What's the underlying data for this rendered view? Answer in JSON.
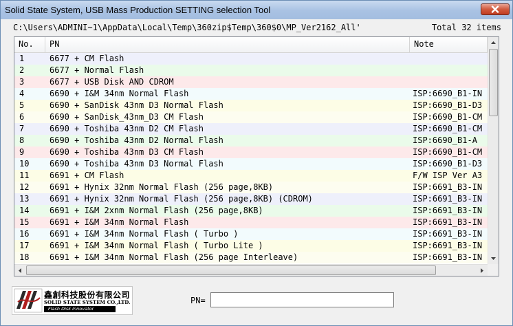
{
  "window": {
    "title": "Solid State System, USB Mass Production SETTING selection Tool",
    "close_icon": "close-icon"
  },
  "path_text": "C:\\Users\\ADMINI~1\\AppData\\Local\\Temp\\360zip$Temp\\360$0\\MP_Ver2162_All'",
  "total_text": "Total 32 items",
  "list": {
    "columns": [
      "No.",
      "PN",
      "Note"
    ],
    "rows": [
      {
        "no": "1",
        "pn": "6677 + CM Flash",
        "note": "",
        "color": "#eef0fb"
      },
      {
        "no": "2",
        "pn": "6677 + Normal Flash",
        "note": "",
        "color": "#eafbea"
      },
      {
        "no": "3",
        "pn": "6677 + USB Disk AND CDROM",
        "note": "",
        "color": "#fde9ea"
      },
      {
        "no": "4",
        "pn": "6690 + I&M 34nm Normal Flash",
        "note": "ISP:6690_B1-IN",
        "color": "#f2fbfd"
      },
      {
        "no": "5",
        "pn": "6690 + SanDisk 43nm D3 Normal Flash",
        "note": "ISP:6690_B1-D3",
        "color": "#fdfde6"
      },
      {
        "no": "6",
        "pn": "6690 + SanDisk_43nm_D3 CM Flash",
        "note": "ISP:6690_B1-CM",
        "color": "#fdfdf0"
      },
      {
        "no": "7",
        "pn": "6690 + Toshiba 43nm D2 CM Flash",
        "note": "ISP:6690_B1-CM",
        "color": "#eef0fb"
      },
      {
        "no": "8",
        "pn": "6690 + Toshiba 43nm D2 Normal Flash",
        "note": "ISP:6690_B1-A",
        "color": "#eafbea"
      },
      {
        "no": "9",
        "pn": "6690 + Toshiba 43nm D3 CM Flash",
        "note": "ISP:6690_B1-CM",
        "color": "#fde9ea"
      },
      {
        "no": "10",
        "pn": "6690 + Toshiba 43nm D3 Normal Flash",
        "note": "ISP:6690_B1-D3",
        "color": "#f2fbfd"
      },
      {
        "no": "11",
        "pn": "6691 + CM Flash",
        "note": "F/W ISP Ver A3",
        "color": "#fdfde6"
      },
      {
        "no": "12",
        "pn": "6691 + Hynix 32nm Normal Flash (256 page,8KB)",
        "note": "ISP:6691_B3-IN",
        "color": "#fdfdf0"
      },
      {
        "no": "13",
        "pn": "6691 + Hynix 32nm Normal Flash (256 page,8KB) (CDROM)",
        "note": "ISP:6691_B3-IN",
        "color": "#eef0fb"
      },
      {
        "no": "14",
        "pn": "6691 + I&M 2xnm Normal Flash (256 page,8KB)",
        "note": "ISP:6691_B3-IN",
        "color": "#eafbea"
      },
      {
        "no": "15",
        "pn": "6691 + I&M 34nm Normal Flash",
        "note": "ISP:6691_B3-IN",
        "color": "#fde9ea"
      },
      {
        "no": "16",
        "pn": "6691 + I&M 34nm Normal Flash ( Turbo )",
        "note": "ISP:6691_B3-IN",
        "color": "#f2fbfd"
      },
      {
        "no": "17",
        "pn": "6691 + I&M 34nm Normal Flash ( Turbo Lite )",
        "note": "ISP:6691_B3-IN",
        "color": "#fdfde6"
      },
      {
        "no": "18",
        "pn": "6691 + I&M 34nm Normal Flash (256 page Interleave)",
        "note": "ISP:6691_B3-IN",
        "color": "#fdfdf0"
      }
    ]
  },
  "logo": {
    "name_cn": "鑫創科技股份有限公司",
    "name_en": "SOLID STATE SYSTEM CO.,LTD.",
    "tagline": "Flash Disk Innovator"
  },
  "pn_field": {
    "label": "PN=",
    "value": ""
  }
}
